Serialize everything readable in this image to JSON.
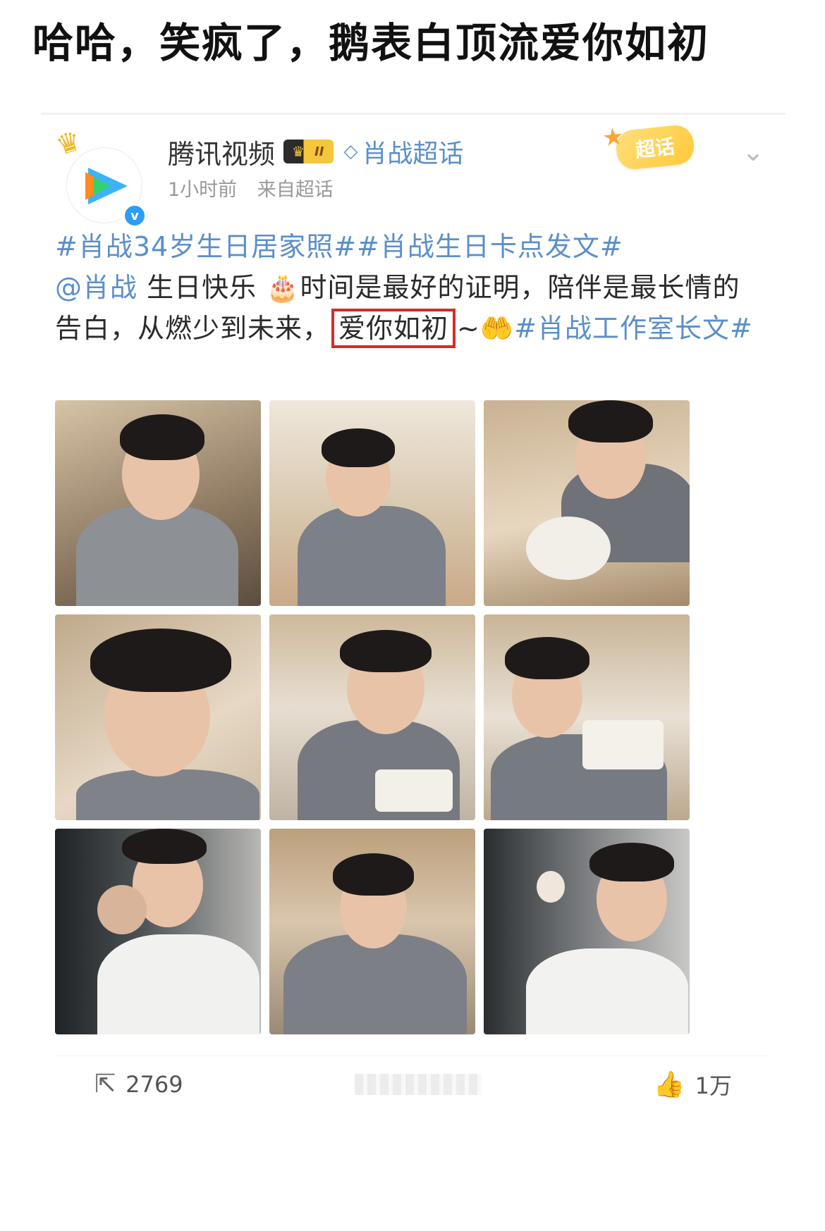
{
  "headline": "哈哈，笑疯了，鹅表白顶流爱你如初",
  "post": {
    "author": "腾讯视频",
    "vip_level": "II",
    "topic": "肖战超话",
    "time": "1小时前",
    "source": "来自超话",
    "super_tag": "超话",
    "text": {
      "hashtags": "#肖战34岁生日居家照##肖战生日卡点发文#",
      "mention": "@肖战",
      "part1": " 生日快乐",
      "cake_emoji": "🎂",
      "part2": "时间是最好的证明，陪伴是最长情的告白，从燃少到未来，",
      "highlight": "爱你如初",
      "tilde": "~",
      "hands_emoji": "🤲",
      "tail_tag": "#肖战工作室长文#"
    },
    "photos": [
      {
        "label": "photo 1"
      },
      {
        "label": "photo 2"
      },
      {
        "label": "photo 3"
      },
      {
        "label": "photo 4"
      },
      {
        "label": "photo 5"
      },
      {
        "label": "photo 6"
      },
      {
        "label": "photo 7"
      },
      {
        "label": "photo 8"
      },
      {
        "label": "photo 9"
      }
    ],
    "shares": "2769",
    "likes": "1万"
  },
  "icons": {
    "share": "share-icon",
    "like": "thumbs-up-icon",
    "more": "chevron-down-icon",
    "verify": "verified-icon"
  },
  "colors": {
    "link": "#5b8fc9",
    "highlight_box": "#d92a27",
    "super_tag": "#ffc93a"
  }
}
